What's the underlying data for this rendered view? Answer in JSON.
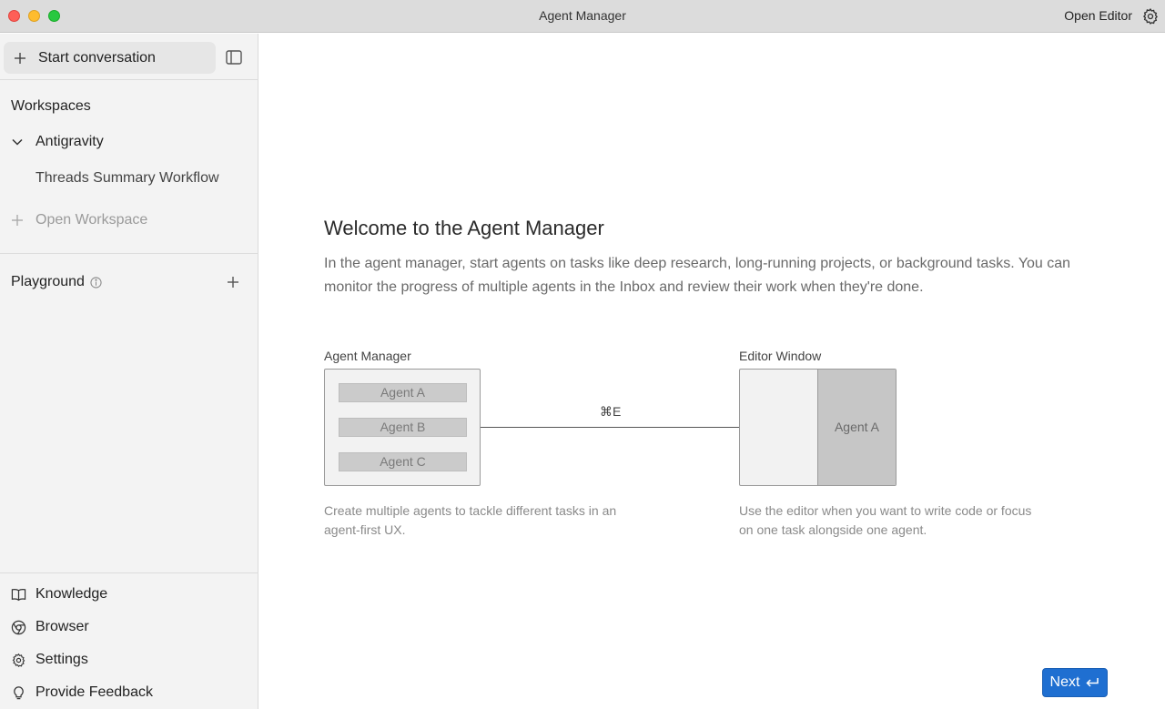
{
  "window": {
    "title": "Agent Manager",
    "open_editor_label": "Open Editor"
  },
  "sidebar": {
    "start_conversation": "Start conversation",
    "workspaces_title": "Workspaces",
    "workspace_name": "Antigravity",
    "thread": "Threads Summary Workflow",
    "open_workspace": "Open Workspace",
    "playground_title": "Playground",
    "bottom_items": [
      {
        "label": "Knowledge",
        "icon": "book-icon"
      },
      {
        "label": "Browser",
        "icon": "chrome-icon"
      },
      {
        "label": "Settings",
        "icon": "gear-icon"
      },
      {
        "label": "Provide Feedback",
        "icon": "lightbulb-icon"
      }
    ]
  },
  "main": {
    "title": "Welcome to the Agent Manager",
    "description": "In the agent manager, start agents on tasks like deep research, long-running projects, or background tasks. You can monitor the progress of multiple agents in the Inbox and review their work when they're done.",
    "diagram": {
      "left_label": "Agent Manager",
      "agents": [
        "Agent A",
        "Agent B",
        "Agent C"
      ],
      "shortcut": "⌘E",
      "right_label": "Editor Window",
      "editor_agent": "Agent A",
      "left_caption": "Create multiple agents to tackle different tasks in an agent-first UX.",
      "right_caption": "Use the editor when you want to write code or focus on one task alongside one agent."
    },
    "next_label": "Next"
  },
  "colors": {
    "accent": "#1f6fd1",
    "sidebar_bg": "#f3f3f3",
    "titlebar_bg": "#dcdcdc"
  }
}
